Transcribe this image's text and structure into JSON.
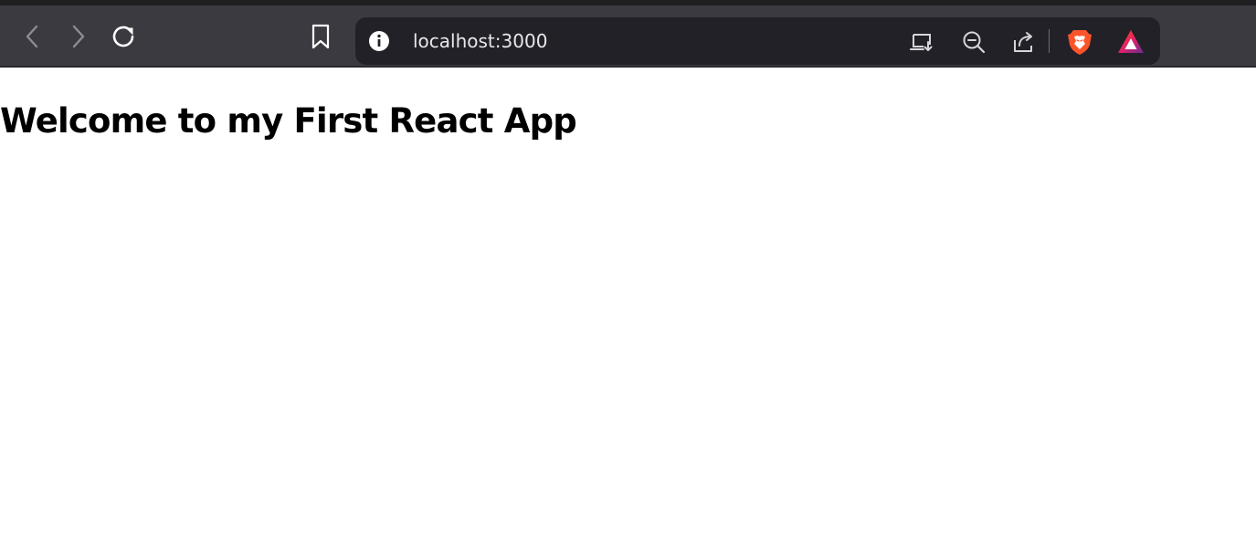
{
  "browser": {
    "address_bar": {
      "url": "localhost:3000"
    },
    "icons": {
      "back": "chevron-left-icon",
      "forward": "chevron-right-icon",
      "reload": "reload-icon",
      "bookmark": "bookmark-icon",
      "site_info": "info-icon",
      "install": "install-app-icon",
      "zoom": "zoom-out-icon",
      "share": "share-icon",
      "shields": "brave-shield-icon",
      "rewards": "brave-rewards-icon"
    },
    "colors": {
      "toolbar": "#3b3a40",
      "address_bar": "#222127",
      "brave_orange": "#fb542b"
    }
  },
  "page": {
    "heading": "Welcome to my First React App"
  }
}
